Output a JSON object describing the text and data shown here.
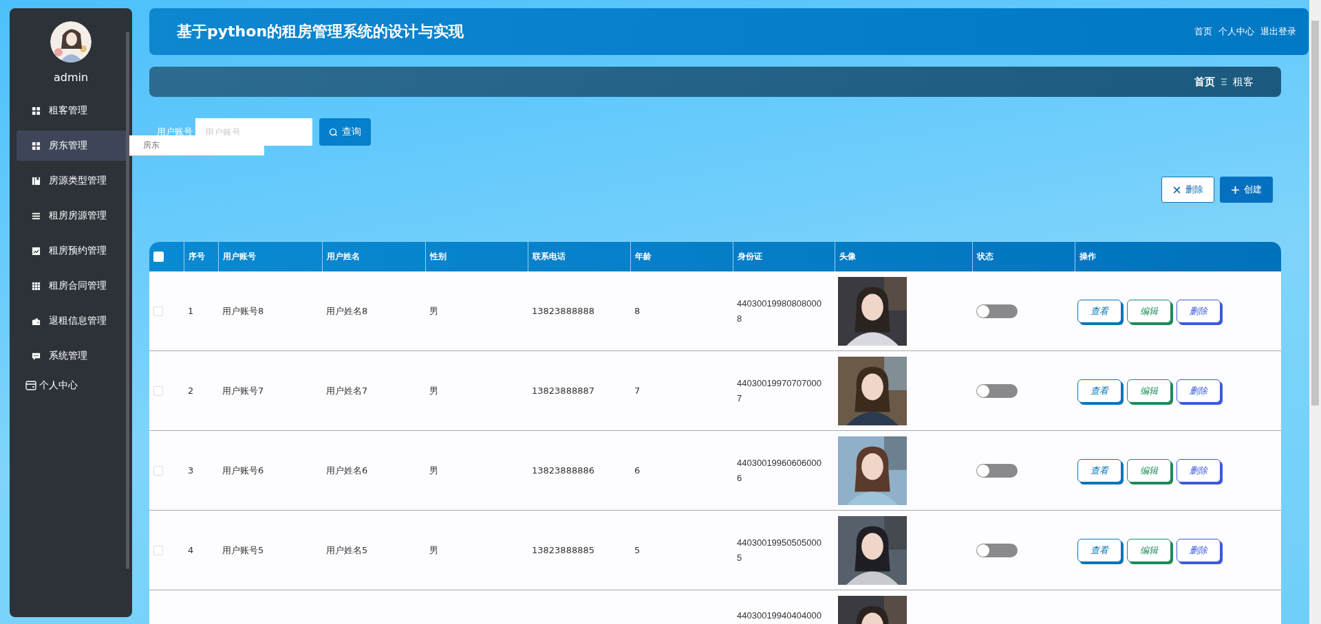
{
  "sidebar": {
    "username": "admin",
    "items": [
      {
        "label": "租客管理",
        "selected": false
      },
      {
        "label": "房东管理",
        "selected": true,
        "submenu": [
          {
            "label": "房东"
          }
        ]
      },
      {
        "label": "房源类型管理",
        "selected": false
      },
      {
        "label": "租房房源管理",
        "selected": false
      },
      {
        "label": "租房预约管理",
        "selected": false
      },
      {
        "label": "租房合同管理",
        "selected": false
      },
      {
        "label": "退租信息管理",
        "selected": false
      },
      {
        "label": "系统管理",
        "selected": false
      }
    ],
    "personal": "个人中心"
  },
  "header": {
    "title": "基于python的租房管理系统的设计与实现",
    "links": [
      "首页",
      "个人中心",
      "退出登录"
    ]
  },
  "breadcrumb": [
    "首页",
    "租客"
  ],
  "search": {
    "label": "用户账号",
    "placeholder": "用户账号",
    "button": "查询"
  },
  "actions": {
    "delete": "删除",
    "create": "创建"
  },
  "table": {
    "columns": [
      "序号",
      "用户账号",
      "用户姓名",
      "性别",
      "联系电话",
      "年龄",
      "身份证",
      "头像",
      "状态",
      "操作"
    ],
    "header_checked": false,
    "rows": [
      {
        "checked": false,
        "seq": "1",
        "account": "用户账号8",
        "name": "用户姓名8",
        "gender": "男",
        "phone": "13823888888",
        "age": "8",
        "idcard": "440300199808080008",
        "on": false,
        "buttons": [
          "查看",
          "编辑",
          "删除"
        ]
      },
      {
        "checked": false,
        "seq": "2",
        "account": "用户账号7",
        "name": "用户姓名7",
        "gender": "男",
        "phone": "13823888887",
        "age": "7",
        "idcard": "440300199707070007",
        "on": false,
        "buttons": [
          "查看",
          "编辑",
          "删除"
        ]
      },
      {
        "checked": false,
        "seq": "3",
        "account": "用户账号6",
        "name": "用户姓名6",
        "gender": "男",
        "phone": "13823888886",
        "age": "6",
        "idcard": "440300199606060006",
        "on": false,
        "buttons": [
          "查看",
          "编辑",
          "删除"
        ]
      },
      {
        "checked": false,
        "seq": "4",
        "account": "用户账号5",
        "name": "用户姓名5",
        "gender": "男",
        "phone": "13823888885",
        "age": "5",
        "idcard": "440300199505050005",
        "on": false,
        "buttons": [
          "查看",
          "编辑",
          "删除"
        ]
      },
      {
        "idcard": "44030019940404000"
      }
    ]
  }
}
